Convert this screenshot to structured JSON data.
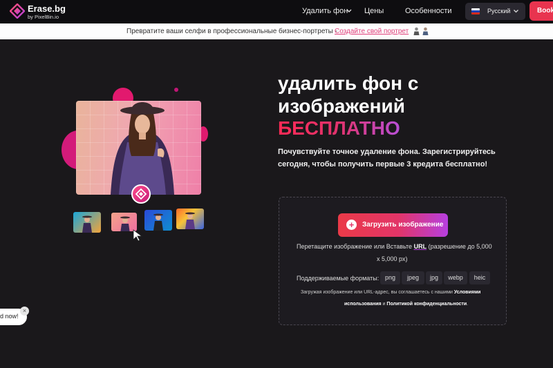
{
  "nav": {
    "logo_name": "Erase.bg",
    "logo_by": "by PixelBin.io",
    "remove_bg_label": "Удалить фон",
    "prices_label": "Цены",
    "features_label": "Особенности",
    "language_label": "Русский",
    "book_label": "Book a"
  },
  "banner": {
    "text": "Превратите ваши селфи в профессиональные бизнес-портреты -",
    "link": "Создайте свой портрет"
  },
  "hero": {
    "title_line1": "удалить фон с",
    "title_line2": "изображений",
    "title_line3": "БЕСПЛАТНО",
    "subtitle_line1": "Почувствуйте точное удаление фона. Зарегистрируйтесь",
    "subtitle_line2": "сегодня, чтобы получить первые 3 кредита бесплатно!"
  },
  "upload": {
    "button_label": "Загрузить изображение",
    "drop_text_before": "Перетащите изображение или Вставьте",
    "drop_url": "URL",
    "drop_text_after": "(разрешение до 5,000",
    "drop_text_line2": "x 5,000 px)",
    "formats_label": "Поддерживаемые форматы:",
    "formats": [
      "png",
      "jpeg",
      "jpg",
      "webp",
      "heic"
    ],
    "terms_line1_before": "Загружая изображение или URL-адрес, вы соглашаетесь с нашими",
    "terms_link1": "Условиями",
    "terms_line2_before": "использования",
    "terms_and": "и",
    "terms_link2": "Политикой конфиденциальности",
    "terms_end": "."
  },
  "popup": {
    "text": "d now!",
    "close": "×"
  },
  "colors": {
    "accent_red": "#e8344f",
    "accent_pink": "#e23568",
    "accent_purple": "#b63fe0",
    "background": "#1a181b"
  }
}
